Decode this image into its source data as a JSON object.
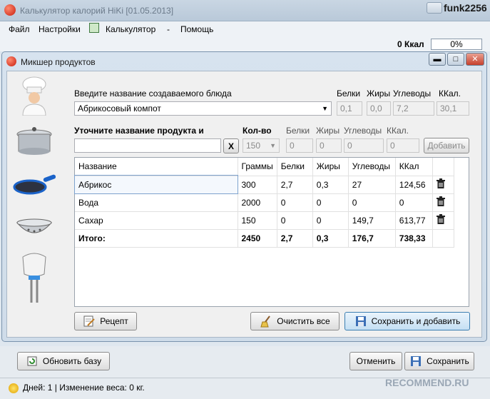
{
  "app": {
    "title": "Калькулятор калорий HiKi [01.05.2013]",
    "user": "funk2256"
  },
  "menu": [
    "Файл",
    "Настройки",
    "Калькулятор",
    "-",
    "Помощь"
  ],
  "kcal_bar": {
    "kcal": "0 Ккал",
    "progress": "0%"
  },
  "dialog": {
    "title": "Микшер продуктов",
    "dish_label": "Введите название создаваемого блюда",
    "dish_value": "Абрикосовый компот",
    "dish_headers": [
      "Белки",
      "Жиры",
      "Углеводы",
      "ККал."
    ],
    "dish_values": [
      "0,1",
      "0,0",
      "7,2",
      "30,1"
    ],
    "product_label": "Уточните название продукта и",
    "product_value": "",
    "clear_x": "X",
    "product_headers": [
      "Кол-во",
      "Белки",
      "Жиры",
      "Углеводы",
      "ККал."
    ],
    "product_values": [
      "150",
      "0",
      "0",
      "0",
      "0"
    ],
    "add_button": "Добавить",
    "table": {
      "columns": [
        "Название",
        "Граммы",
        "Белки",
        "Жиры",
        "Углеводы",
        "ККал"
      ],
      "rows": [
        [
          "Абрикос",
          "300",
          "2,7",
          "0,3",
          "27",
          "124,56"
        ],
        [
          "Вода",
          "2000",
          "0",
          "0",
          "0",
          "0"
        ],
        [
          "Сахар",
          "150",
          "0",
          "0",
          "149,7",
          "613,77"
        ]
      ],
      "total": [
        "Итого:",
        "2450",
        "2,7",
        "0,3",
        "176,7",
        "738,33"
      ]
    },
    "recipe_button": "Рецепт",
    "clear_all_button": "Очистить все",
    "save_add_button": "Сохранить и добавить"
  },
  "bottom": {
    "update_button": "Обновить базу",
    "cancel_button": "Отменить",
    "save_button": "Сохранить"
  },
  "status": "Дней: 1 | Изменение веса: 0 кг.",
  "watermark": "RECOMMEND.RU"
}
